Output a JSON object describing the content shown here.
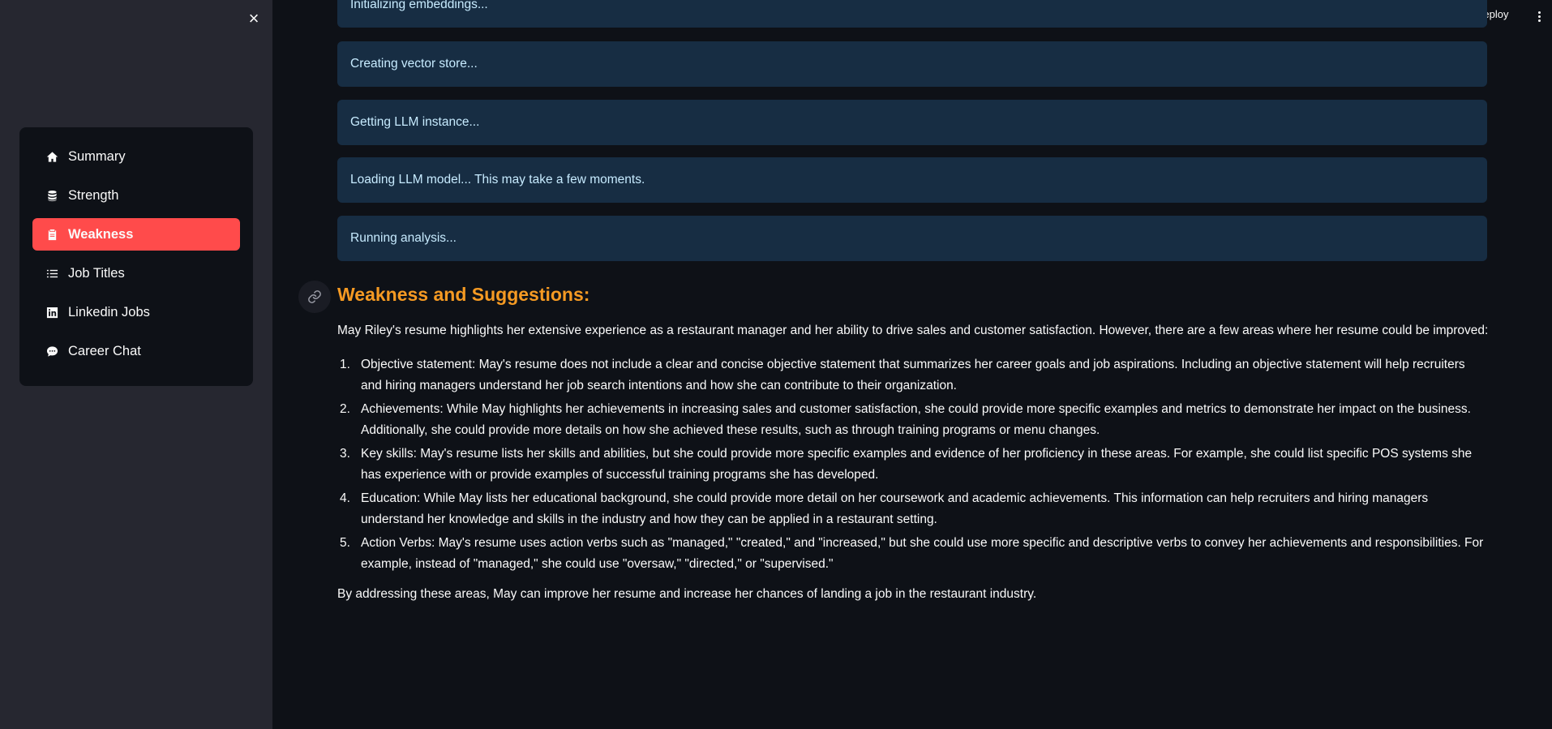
{
  "header": {
    "deploy_label": "Deploy"
  },
  "sidebar": {
    "close_label": "×",
    "items": [
      {
        "label": "Summary",
        "icon": "house-icon"
      },
      {
        "label": "Strength",
        "icon": "database-icon"
      },
      {
        "label": "Weakness",
        "icon": "clipboard-icon",
        "active": true
      },
      {
        "label": "Job Titles",
        "icon": "list-icon"
      },
      {
        "label": "Linkedin Jobs",
        "icon": "linkedin-icon"
      },
      {
        "label": "Career Chat",
        "icon": "chat-icon"
      }
    ]
  },
  "status_messages": [
    "Initializing embeddings...",
    "Creating vector store...",
    "Getting LLM instance...",
    "Loading LLM model... This may take a few moments.",
    "Running analysis..."
  ],
  "result": {
    "heading": "Weakness and Suggestions:",
    "intro": "May Riley's resume highlights her extensive experience as a restaurant manager and her ability to drive sales and customer satisfaction. However, there are a few areas where her resume could be improved:",
    "points": [
      {
        "num": "1.",
        "text": "Objective statement: May's resume does not include a clear and concise objective statement that summarizes her career goals and job aspirations. Including an objective statement will help recruiters and hiring managers understand her job search intentions and how she can contribute to their organization."
      },
      {
        "num": "2.",
        "text": "Achievements: While May highlights her achievements in increasing sales and customer satisfaction, she could provide more specific examples and metrics to demonstrate her impact on the business. Additionally, she could provide more details on how she achieved these results, such as through training programs or menu changes."
      },
      {
        "num": "3.",
        "text": "Key skills: May's resume lists her skills and abilities, but she could provide more specific examples and evidence of her proficiency in these areas. For example, she could list specific POS systems she has experience with or provide examples of successful training programs she has developed."
      },
      {
        "num": "4.",
        "text": "Education: While May lists her educational background, she could provide more detail on her coursework and academic achievements. This information can help recruiters and hiring managers understand her knowledge and skills in the industry and how they can be applied in a restaurant setting."
      },
      {
        "num": "5.",
        "text": "Action Verbs: May's resume uses action verbs such as \"managed,\" \"created,\" and \"increased,\" but she could use more specific and descriptive verbs to convey her achievements and responsibilities. For example, instead of \"managed,\" she could use \"oversaw,\" \"directed,\" or \"supervised.\""
      }
    ],
    "outro": "By addressing these areas, May can improve her resume and increase her chances of landing a job in the restaurant industry."
  },
  "colors": {
    "accent": "#ff4b4b",
    "heading": "#f59a23",
    "status_bg": "#172d43",
    "status_text": "#c7ebff",
    "sidebar_bg": "#262730",
    "main_bg": "#0e1117"
  }
}
